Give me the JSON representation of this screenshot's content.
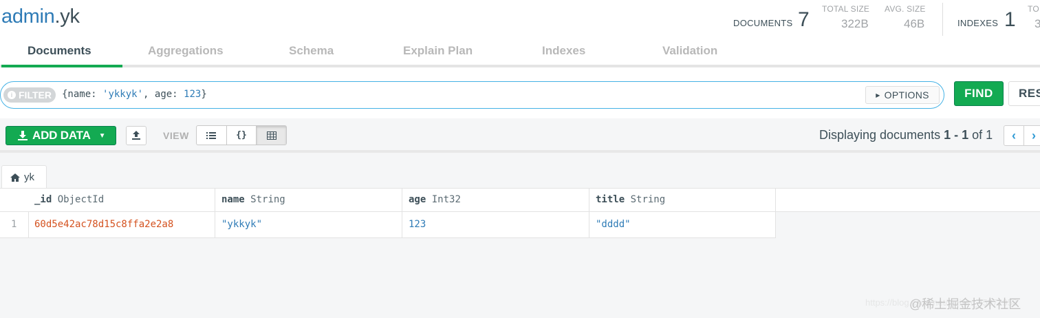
{
  "header": {
    "db_name": "admin",
    "dot": ".",
    "collection_name": "yk",
    "documents_label": "DOCUMENTS",
    "documents_count": "7",
    "total_size_label": "TOTAL SIZE",
    "total_size_value": "322B",
    "avg_size_label": "AVG. SIZE",
    "avg_size_value": "46B",
    "indexes_label": "INDEXES",
    "indexes_count": "1",
    "clipped_label": "TO",
    "clipped_value": "3"
  },
  "tabs": [
    {
      "label": "Documents",
      "active": true
    },
    {
      "label": "Aggregations"
    },
    {
      "label": "Schema"
    },
    {
      "label": "Explain Plan"
    },
    {
      "label": "Indexes"
    },
    {
      "label": "Validation"
    }
  ],
  "filter": {
    "pill_label": "FILTER",
    "query_open": "{name: ",
    "query_str": "'ykkyk'",
    "query_mid": ", age: ",
    "query_num": "123",
    "query_close": "}",
    "options_label": "OPTIONS",
    "find_label": "FIND",
    "reset_label": "RES"
  },
  "toolbar": {
    "add_data_label": "ADD DATA",
    "view_label": "VIEW",
    "view_modes": [
      "list",
      "json",
      "table"
    ],
    "active_view": "table",
    "display_prefix": "Displaying documents ",
    "display_range": "1 - 1",
    "display_of": " of ",
    "display_total": "1"
  },
  "table": {
    "breadcrumb": "yk",
    "columns": [
      {
        "name": "_id",
        "type": "ObjectId"
      },
      {
        "name": "name",
        "type": "String"
      },
      {
        "name": "age",
        "type": "Int32"
      },
      {
        "name": "title",
        "type": "String"
      }
    ],
    "rows": [
      {
        "num": "1",
        "cells": [
          "60d5e42ac78d15c8ffa2e2a8",
          "\"ykkyk\"",
          "123",
          "\"dddd\""
        ]
      }
    ]
  },
  "watermark": {
    "faint_text": "https://blog.csdn.net/weixin_45372958",
    "text": "@稀土掘金技术社区"
  },
  "colors": {
    "accent_green": "#13aa52",
    "db_blue": "#2e7bb6",
    "objectid_orange": "#d4521f"
  }
}
